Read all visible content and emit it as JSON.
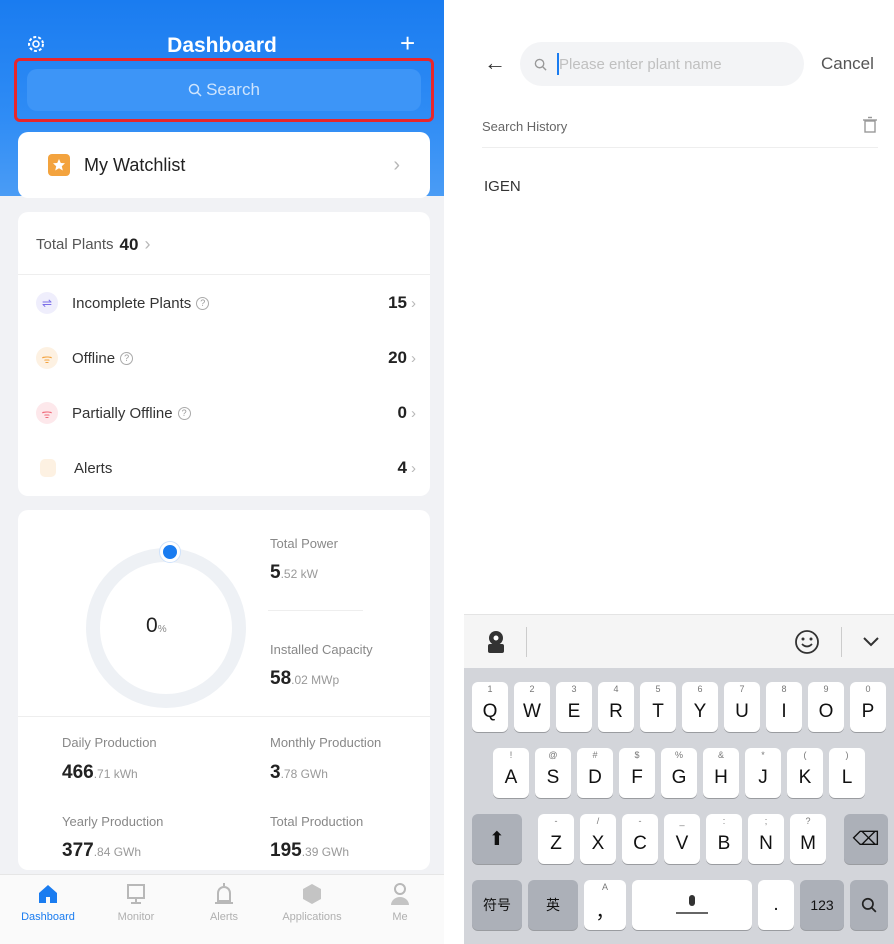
{
  "dashboard": {
    "title": "Dashboard",
    "search_placeholder": "Search",
    "watchlist_label": "My Watchlist",
    "total_plants_label": "Total Plants",
    "total_plants_value": "40",
    "rows": [
      {
        "label": "Incomplete Plants",
        "value": "15",
        "icon": "incomplete-icon",
        "color": "#7b6ee8"
      },
      {
        "label": "Offline",
        "value": "20",
        "icon": "wifi-offline-icon",
        "color": "#f3a33e"
      },
      {
        "label": "Partially Offline",
        "value": "0",
        "icon": "wifi-partial-icon",
        "color": "#f06a7a"
      },
      {
        "label": "Alerts",
        "value": "4",
        "icon": "alert-icon",
        "color": "#f3a33e"
      }
    ],
    "power_percent": "0",
    "percent_unit": "%",
    "total_power": {
      "label": "Total Power",
      "value": "5",
      "unit": ".52 kW"
    },
    "installed_capacity": {
      "label": "Installed Capacity",
      "value": "58",
      "unit": ".02 MWp"
    },
    "daily": {
      "label": "Daily Production",
      "value": "466",
      "unit": ".71 kWh"
    },
    "monthly": {
      "label": "Monthly Production",
      "value": "3",
      "unit": ".78 GWh"
    },
    "yearly": {
      "label": "Yearly Production",
      "value": "377",
      "unit": ".84 GWh"
    },
    "total": {
      "label": "Total Production",
      "value": "195",
      "unit": ".39 GWh"
    },
    "tabs": [
      "Dashboard",
      "Monitor",
      "Alerts",
      "Applications",
      "Me"
    ],
    "active_tab": "Dashboard",
    "accent": "#1a7cf0"
  },
  "search_screen": {
    "placeholder": "Please enter plant name",
    "cancel_label": "Cancel",
    "history_label": "Search History",
    "history_items": [
      "IGEN"
    ]
  },
  "keyboard": {
    "row1": [
      {
        "k": "Q",
        "n": "1"
      },
      {
        "k": "W",
        "n": "2"
      },
      {
        "k": "E",
        "n": "3"
      },
      {
        "k": "R",
        "n": "4"
      },
      {
        "k": "T",
        "n": "5"
      },
      {
        "k": "Y",
        "n": "6"
      },
      {
        "k": "U",
        "n": "7"
      },
      {
        "k": "I",
        "n": "8"
      },
      {
        "k": "O",
        "n": "9"
      },
      {
        "k": "P",
        "n": "0"
      }
    ],
    "row2": [
      {
        "k": "A",
        "n": "!"
      },
      {
        "k": "S",
        "n": "@"
      },
      {
        "k": "D",
        "n": "#"
      },
      {
        "k": "F",
        "n": "$"
      },
      {
        "k": "G",
        "n": "%"
      },
      {
        "k": "H",
        "n": "&"
      },
      {
        "k": "J",
        "n": "*"
      },
      {
        "k": "K",
        "n": "("
      },
      {
        "k": "L",
        "n": ")"
      }
    ],
    "row3": [
      {
        "k": "Z",
        "n": "-"
      },
      {
        "k": "X",
        "n": "/"
      },
      {
        "k": "C",
        "n": "-"
      },
      {
        "k": "V",
        "n": "_"
      },
      {
        "k": "B",
        "n": ":"
      },
      {
        "k": "N",
        "n": ";"
      },
      {
        "k": "M",
        "n": "?"
      }
    ],
    "symbols_label": "符号",
    "lang_label": "英",
    "num_label": "123",
    "space_label": "",
    "comma_label": "，",
    "period_label": "."
  }
}
